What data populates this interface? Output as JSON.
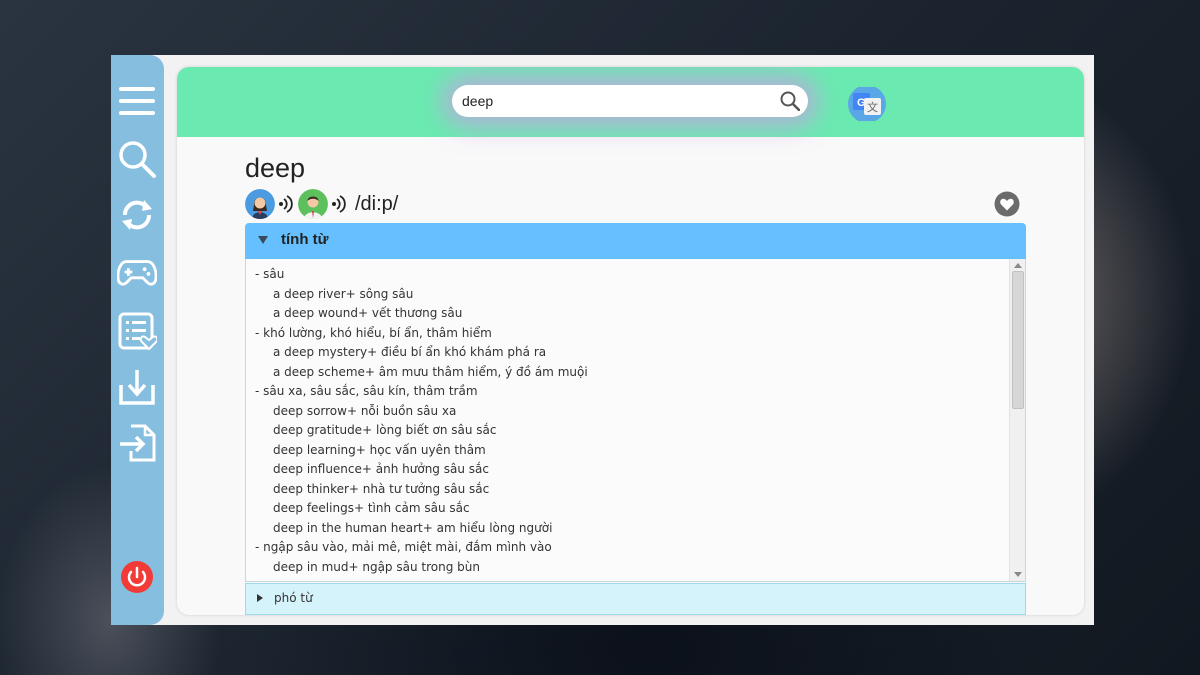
{
  "app": {
    "accent_color": "#6aeab0",
    "sidebar_color": "#86bedf",
    "header_color": "#66bfff"
  },
  "sidebar": {
    "items": [
      {
        "icon": "menu-icon"
      },
      {
        "icon": "search-icon"
      },
      {
        "icon": "refresh-icon"
      },
      {
        "icon": "gamepad-icon"
      },
      {
        "icon": "favorites-list-icon"
      },
      {
        "icon": "download-icon"
      },
      {
        "icon": "import-icon"
      }
    ],
    "power_icon": "power-icon"
  },
  "search": {
    "value": "deep",
    "icon": "search-icon"
  },
  "translate_button": {
    "icon": "google-translate-icon"
  },
  "entry": {
    "word": "deep",
    "phonetic": "/di:p/",
    "favorite_icon": "heart-icon"
  },
  "sections": [
    {
      "label": "tính từ",
      "expanded": true,
      "lines": [
        {
          "type": "meaning",
          "text": "- sâu"
        },
        {
          "type": "example",
          "text": "a deep river+ sông sâu"
        },
        {
          "type": "example",
          "text": "a deep wound+ vết thương sâu"
        },
        {
          "type": "meaning",
          "text": "- khó lường, khó hiểu, bí ẩn, thâm hiểm"
        },
        {
          "type": "example",
          "text": "a deep mystery+ điều bí ẩn khó khám phá ra"
        },
        {
          "type": "example",
          "text": "a deep scheme+ âm mưu thâm hiểm, ý đồ ám muội"
        },
        {
          "type": "meaning",
          "text": "- sâu xa, sâu sắc, sâu kín, thâm trầm"
        },
        {
          "type": "example",
          "text": "deep sorrow+ nỗi buồn sâu xa"
        },
        {
          "type": "example",
          "text": "deep gratitude+ lòng biết ơn sâu sắc"
        },
        {
          "type": "example",
          "text": "deep learning+ học vấn uyên thâm"
        },
        {
          "type": "example",
          "text": "deep influence+ ảnh hưởng sâu sắc"
        },
        {
          "type": "example",
          "text": "deep thinker+ nhà tư tưởng sâu sắc"
        },
        {
          "type": "example",
          "text": "deep feelings+ tình cảm sâu sắc"
        },
        {
          "type": "example",
          "text": "deep in the human heart+ am hiểu lòng người"
        },
        {
          "type": "meaning",
          "text": "- ngập sâu vào, mải mê, miệt mài, đắm mình vào"
        },
        {
          "type": "example",
          "text": "deep in mud+ ngập sâu trong bùn"
        }
      ]
    },
    {
      "label": "phó từ",
      "expanded": false
    }
  ]
}
